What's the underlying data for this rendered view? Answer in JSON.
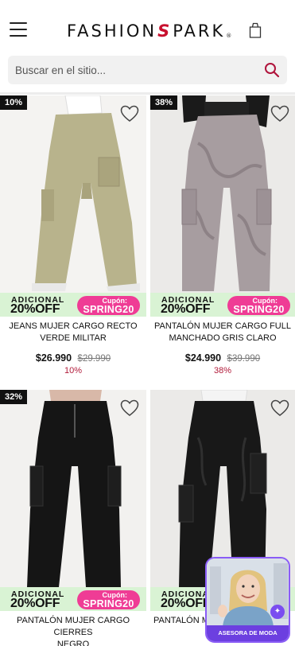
{
  "header": {
    "brand_left": "FASHION",
    "brand_s": "S",
    "brand_right": "PARK",
    "brand_reg": "®",
    "menu_icon": "hamburger-icon",
    "bag_icon": "shopping-bag-icon"
  },
  "search": {
    "placeholder": "Buscar en el sitio...",
    "icon": "search-icon"
  },
  "colors": {
    "brand_red": "#c8102e",
    "promo_green": "#d9f3d4",
    "coupon_pink": "#ef3c95",
    "discount_red": "#b11b3a",
    "advisor_purple": "#6c3fe0"
  },
  "products": [
    {
      "discount_badge": "10%",
      "promo_adicional": "ADICIONAL",
      "promo_off": "20%OFF",
      "coupon_label": "Cupón:",
      "coupon_code": "SPRING20",
      "name_line1": "JEANS MUJER CARGO RECTO",
      "name_line2": "VERDE MILITAR",
      "price": "$26.990",
      "old_price": "$29.990",
      "discount_text": "10%"
    },
    {
      "discount_badge": "38%",
      "promo_adicional": "ADICIONAL",
      "promo_off": "20%OFF",
      "coupon_label": "Cupón:",
      "coupon_code": "SPRING20",
      "name_line1": "PANTALÓN MUJER CARGO FULL",
      "name_line2": "MANCHADO GRIS CLARO",
      "price": "$24.990",
      "old_price": "$39.990",
      "discount_text": "38%"
    },
    {
      "discount_badge": "32%",
      "promo_adicional": "ADICIONAL",
      "promo_off": "20%OFF",
      "coupon_label": "Cupón:",
      "coupon_code": "SPRING20",
      "name_line1": "PANTALÓN MUJER CARGO CIERRES",
      "name_line2": "NEGRO"
    },
    {
      "promo_adicional": "ADICIONAL",
      "promo_off": "20%OFF",
      "name_line1": "PANTALÓN M"
    }
  ],
  "advisor": {
    "button_label": "ASESORA DE MODA",
    "icon": "sparkle-icon"
  }
}
